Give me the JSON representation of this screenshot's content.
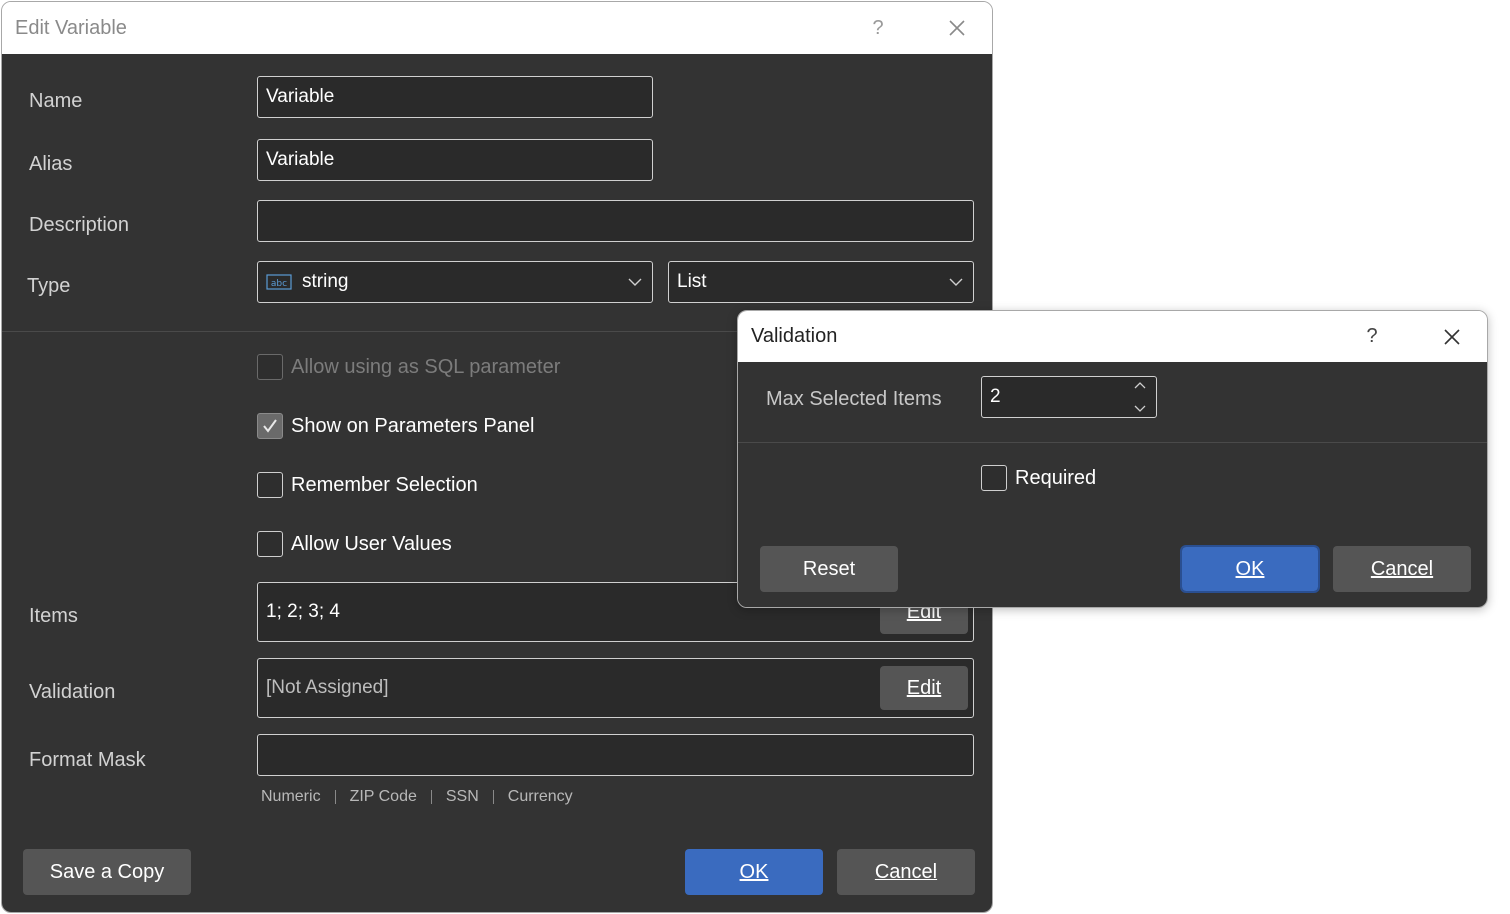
{
  "edit_variable": {
    "title": "Edit Variable",
    "help_label": "?",
    "labels": {
      "name": "Name",
      "alias": "Alias",
      "description": "Description",
      "type": "Type",
      "items": "Items",
      "validation": "Validation",
      "format_mask": "Format Mask"
    },
    "name_value": "Variable",
    "alias_value": "Variable",
    "description_value": "",
    "type_value": "string",
    "type_icon": "abc-string-icon",
    "kind_value": "List",
    "checkboxes": [
      {
        "label": "Allow using as SQL parameter",
        "checked": false,
        "disabled": true
      },
      {
        "label": "Show on Parameters Panel",
        "checked": true,
        "disabled": false
      },
      {
        "label": "Remember Selection",
        "checked": false,
        "disabled": false
      },
      {
        "label": "Allow User Values",
        "checked": false,
        "disabled": false
      }
    ],
    "items_value": "1; 2; 3; 4",
    "items_edit_label": "Edit",
    "validation_value": "[Not Assigned]",
    "validation_edit_label": "Edit",
    "format_mask_value": "",
    "mask_presets": [
      "Numeric",
      "ZIP Code",
      "SSN",
      "Currency"
    ],
    "save_copy_label": "Save a Copy",
    "ok_label": "OK",
    "cancel_label": "Cancel"
  },
  "validation_dialog": {
    "title": "Validation",
    "help_label": "?",
    "max_selected_label": "Max Selected Items",
    "max_selected_value": "2",
    "required_label": "Required",
    "required_checked": false,
    "reset_label": "Reset",
    "ok_label": "OK",
    "cancel_label": "Cancel"
  },
  "colors": {
    "body_bg": "#333333",
    "accent": "#3a6bbf",
    "button_bg": "#555555"
  }
}
